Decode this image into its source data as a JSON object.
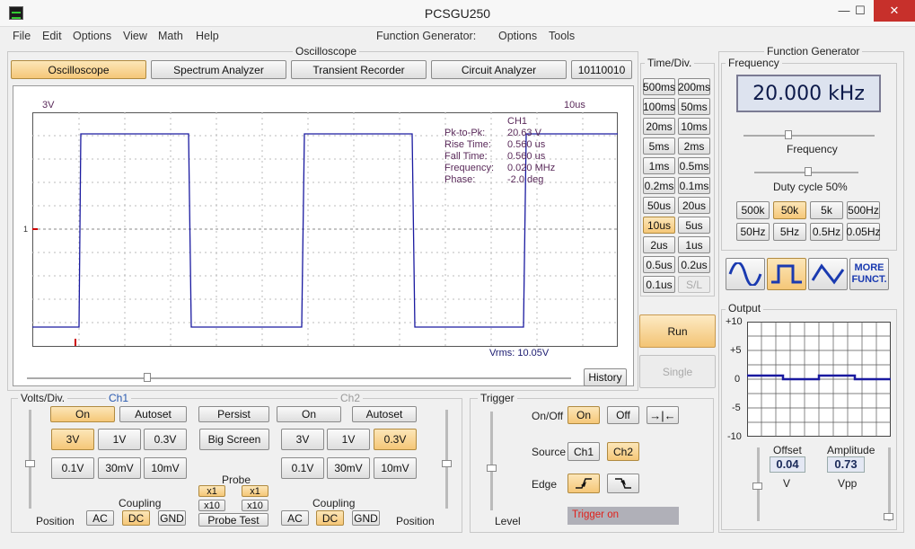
{
  "window": {
    "title": "PCSGU250",
    "minimize": "—",
    "maximize": "☐",
    "close": "✕"
  },
  "menu": {
    "left": [
      "File",
      "Edit",
      "Options",
      "View",
      "Math",
      "Help"
    ],
    "fg_label": "Function Generator:",
    "fg_items": [
      "Options",
      "Tools"
    ]
  },
  "osc": {
    "group_title": "Oscilloscope",
    "tabs": [
      "Oscilloscope",
      "Spectrum Analyzer",
      "Transient Recorder",
      "Circuit Analyzer",
      "10110010"
    ],
    "screen": {
      "volts_label": "3V",
      "time_label": "10us",
      "marker": "1",
      "vrms": "Vrms: 10.05V"
    },
    "measurements": {
      "channel": "CH1",
      "rows": [
        [
          "Pk-to-Pk:",
          "20.63 V"
        ],
        [
          "Rise Time:",
          "0.560 us"
        ],
        [
          "Fall Time:",
          "0.560 us"
        ],
        [
          "Frequency:",
          "0.020 MHz"
        ],
        [
          "Phase:",
          "-2.0 deg"
        ]
      ]
    },
    "history": "History"
  },
  "timediv": {
    "title": "Time/Div.",
    "buttons": [
      [
        "500ms",
        "200ms"
      ],
      [
        "100ms",
        "50ms"
      ],
      [
        "20ms",
        "10ms"
      ],
      [
        "5ms",
        "2ms"
      ],
      [
        "1ms",
        "0.5ms"
      ],
      [
        "0.2ms",
        "0.1ms"
      ],
      [
        "50us",
        "20us"
      ],
      [
        "10us",
        "5us"
      ],
      [
        "2us",
        "1us"
      ],
      [
        "0.5us",
        "0.2us"
      ],
      [
        "0.1us",
        "S/L"
      ]
    ],
    "selected": "10us",
    "disabled": "S/L",
    "run": "Run",
    "single": "Single"
  },
  "volts": {
    "title": "Volts/Div.",
    "ch1": "Ch1",
    "ch2": "Ch2",
    "on": "On",
    "autoset": "Autoset",
    "persist": "Persist",
    "big_screen": "Big Screen",
    "ch1_row1": [
      "3V",
      "1V",
      "0.3V"
    ],
    "ch1_row2": [
      "0.1V",
      "30mV",
      "10mV"
    ],
    "ch2_row1": [
      "3V",
      "1V",
      "0.3V"
    ],
    "ch2_row2": [
      "0.1V",
      "30mV",
      "10mV"
    ],
    "ch1_selected": "3V",
    "ch2_selected": "0.3V",
    "probe": "Probe",
    "x1": "x1",
    "x10": "x10",
    "probe_test": "Probe Test",
    "coupling": "Coupling",
    "ac": "AC",
    "dc": "DC",
    "gnd": "GND",
    "position": "Position"
  },
  "trigger": {
    "title": "Trigger",
    "onoff": "On/Off",
    "on": "On",
    "off": "Off",
    "source": "Source",
    "ch1": "Ch1",
    "ch2": "Ch2",
    "edge": "Edge",
    "level": "Level",
    "status": "Trigger on",
    "status_color": "#e0201a"
  },
  "fg": {
    "title": "Function Generator",
    "frequency_group": "Frequency",
    "display": "20.000 kHz",
    "freq_label": "Frequency",
    "duty": "Duty cycle 50%",
    "range_row1": [
      "500k",
      "50k",
      "5k",
      "500Hz"
    ],
    "range_row2": [
      "50Hz",
      "5Hz",
      "0.5Hz",
      "0.05Hz"
    ],
    "range_selected": "50k",
    "more": "MORE FUNCT.",
    "output_group": "Output",
    "y_ticks": [
      "+10",
      "+5",
      "0",
      "-5",
      "-10"
    ],
    "offset_label": "Offset",
    "offset_value": "0.04",
    "offset_unit": "V",
    "amp_label": "Amplitude",
    "amp_value": "0.73",
    "amp_unit": "Vpp"
  },
  "colors": {
    "trace": "#1a1aa0",
    "accent": "#f5c778"
  }
}
